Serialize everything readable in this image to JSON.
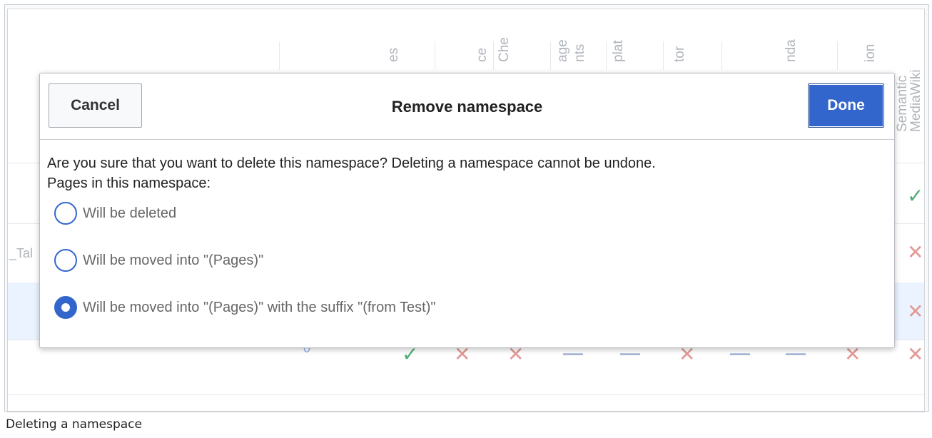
{
  "background_table": {
    "column_labels": [
      "es",
      "ce",
      "Che",
      "age",
      "nts",
      "plat",
      "tor",
      "nda",
      "ion",
      "Semantic",
      "MediaWiki"
    ],
    "row_fragment": "_Tal",
    "count_value": "0",
    "row_marks": {
      "row1": [
        "check"
      ],
      "row2": [
        "cross"
      ],
      "row3": [
        "cross"
      ],
      "row4": [
        "check",
        "cross",
        "cross",
        "dash",
        "dash",
        "cross",
        "dash",
        "dash",
        "cross",
        "cross"
      ]
    },
    "selected_row_color": "#eaf3ff"
  },
  "dialog": {
    "title": "Remove namespace",
    "cancel_label": "Cancel",
    "done_label": "Done",
    "message_line1": "Are you sure that you want to delete this namespace? Deleting a namespace cannot be undone.",
    "message_line2": "Pages in this namespace:",
    "options": [
      {
        "label": "Will be deleted",
        "selected": false
      },
      {
        "label": "Will be moved into \"(Pages)\"",
        "selected": false
      },
      {
        "label": "Will be moved into \"(Pages)\" with the suffix \"(from Test)\"",
        "selected": true
      }
    ],
    "accent_color": "#3366cc"
  },
  "caption": "Deleting a namespace"
}
